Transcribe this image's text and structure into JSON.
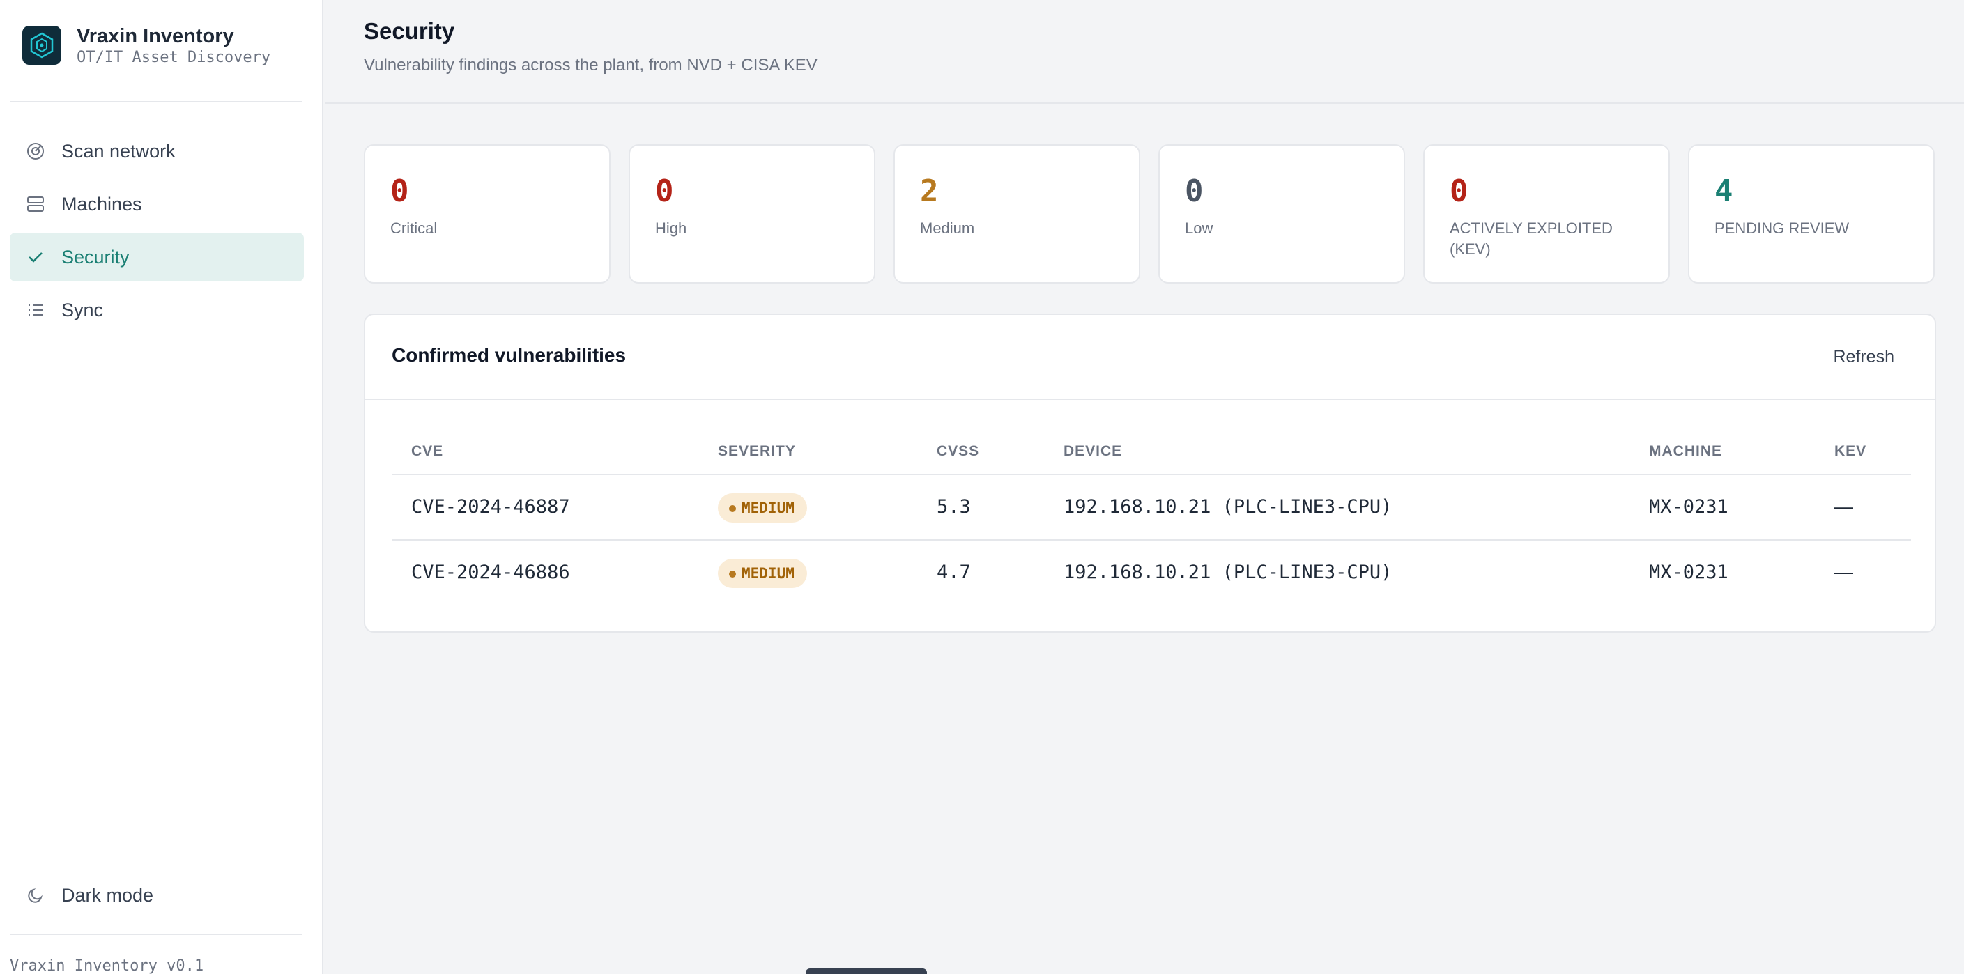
{
  "app": {
    "name": "Vraxin Inventory",
    "subtitle": "OT/IT Asset Discovery",
    "version": "Vraxin Inventory v0.1"
  },
  "sidebar": {
    "items": [
      {
        "label": "Scan network",
        "icon": "radar-icon",
        "active": false
      },
      {
        "label": "Machines",
        "icon": "server-icon",
        "active": false
      },
      {
        "label": "Security",
        "icon": "check-icon",
        "active": true
      },
      {
        "label": "Sync",
        "icon": "list-icon",
        "active": false
      }
    ],
    "dark_mode_label": "Dark mode"
  },
  "header": {
    "title": "Security",
    "subtitle": "Vulnerability findings across the plant, from NVD + CISA KEV"
  },
  "stats": [
    {
      "value": "0",
      "label": "Critical",
      "color": "#b42318"
    },
    {
      "value": "0",
      "label": "High",
      "color": "#b42318"
    },
    {
      "value": "2",
      "label": "Medium",
      "color": "#b7791f"
    },
    {
      "value": "0",
      "label": "Low",
      "color": "#4b5563"
    },
    {
      "value": "0",
      "label": "ACTIVELY EXPLOITED (KEV)",
      "color": "#b42318"
    },
    {
      "value": "4",
      "label": "PENDING REVIEW",
      "color": "#1a7f73"
    }
  ],
  "panel": {
    "title": "Confirmed vulnerabilities",
    "refresh_label": "Refresh",
    "columns": [
      "CVE",
      "SEVERITY",
      "CVSS",
      "DEVICE",
      "MACHINE",
      "KEV"
    ],
    "rows": [
      {
        "cve": "CVE-2024-46887",
        "severity": "MEDIUM",
        "cvss": "5.3",
        "device": "192.168.10.21 (PLC-LINE3-CPU)",
        "machine": "MX-0231",
        "kev": "—"
      },
      {
        "cve": "CVE-2024-46886",
        "severity": "MEDIUM",
        "cvss": "4.7",
        "device": "192.168.10.21 (PLC-LINE3-CPU)",
        "machine": "MX-0231",
        "kev": "—"
      }
    ]
  },
  "colors": {
    "accent": "#1a7f73",
    "critical": "#b42318",
    "medium": "#b7791f",
    "active_nav_bg": "#e3f1ef"
  }
}
